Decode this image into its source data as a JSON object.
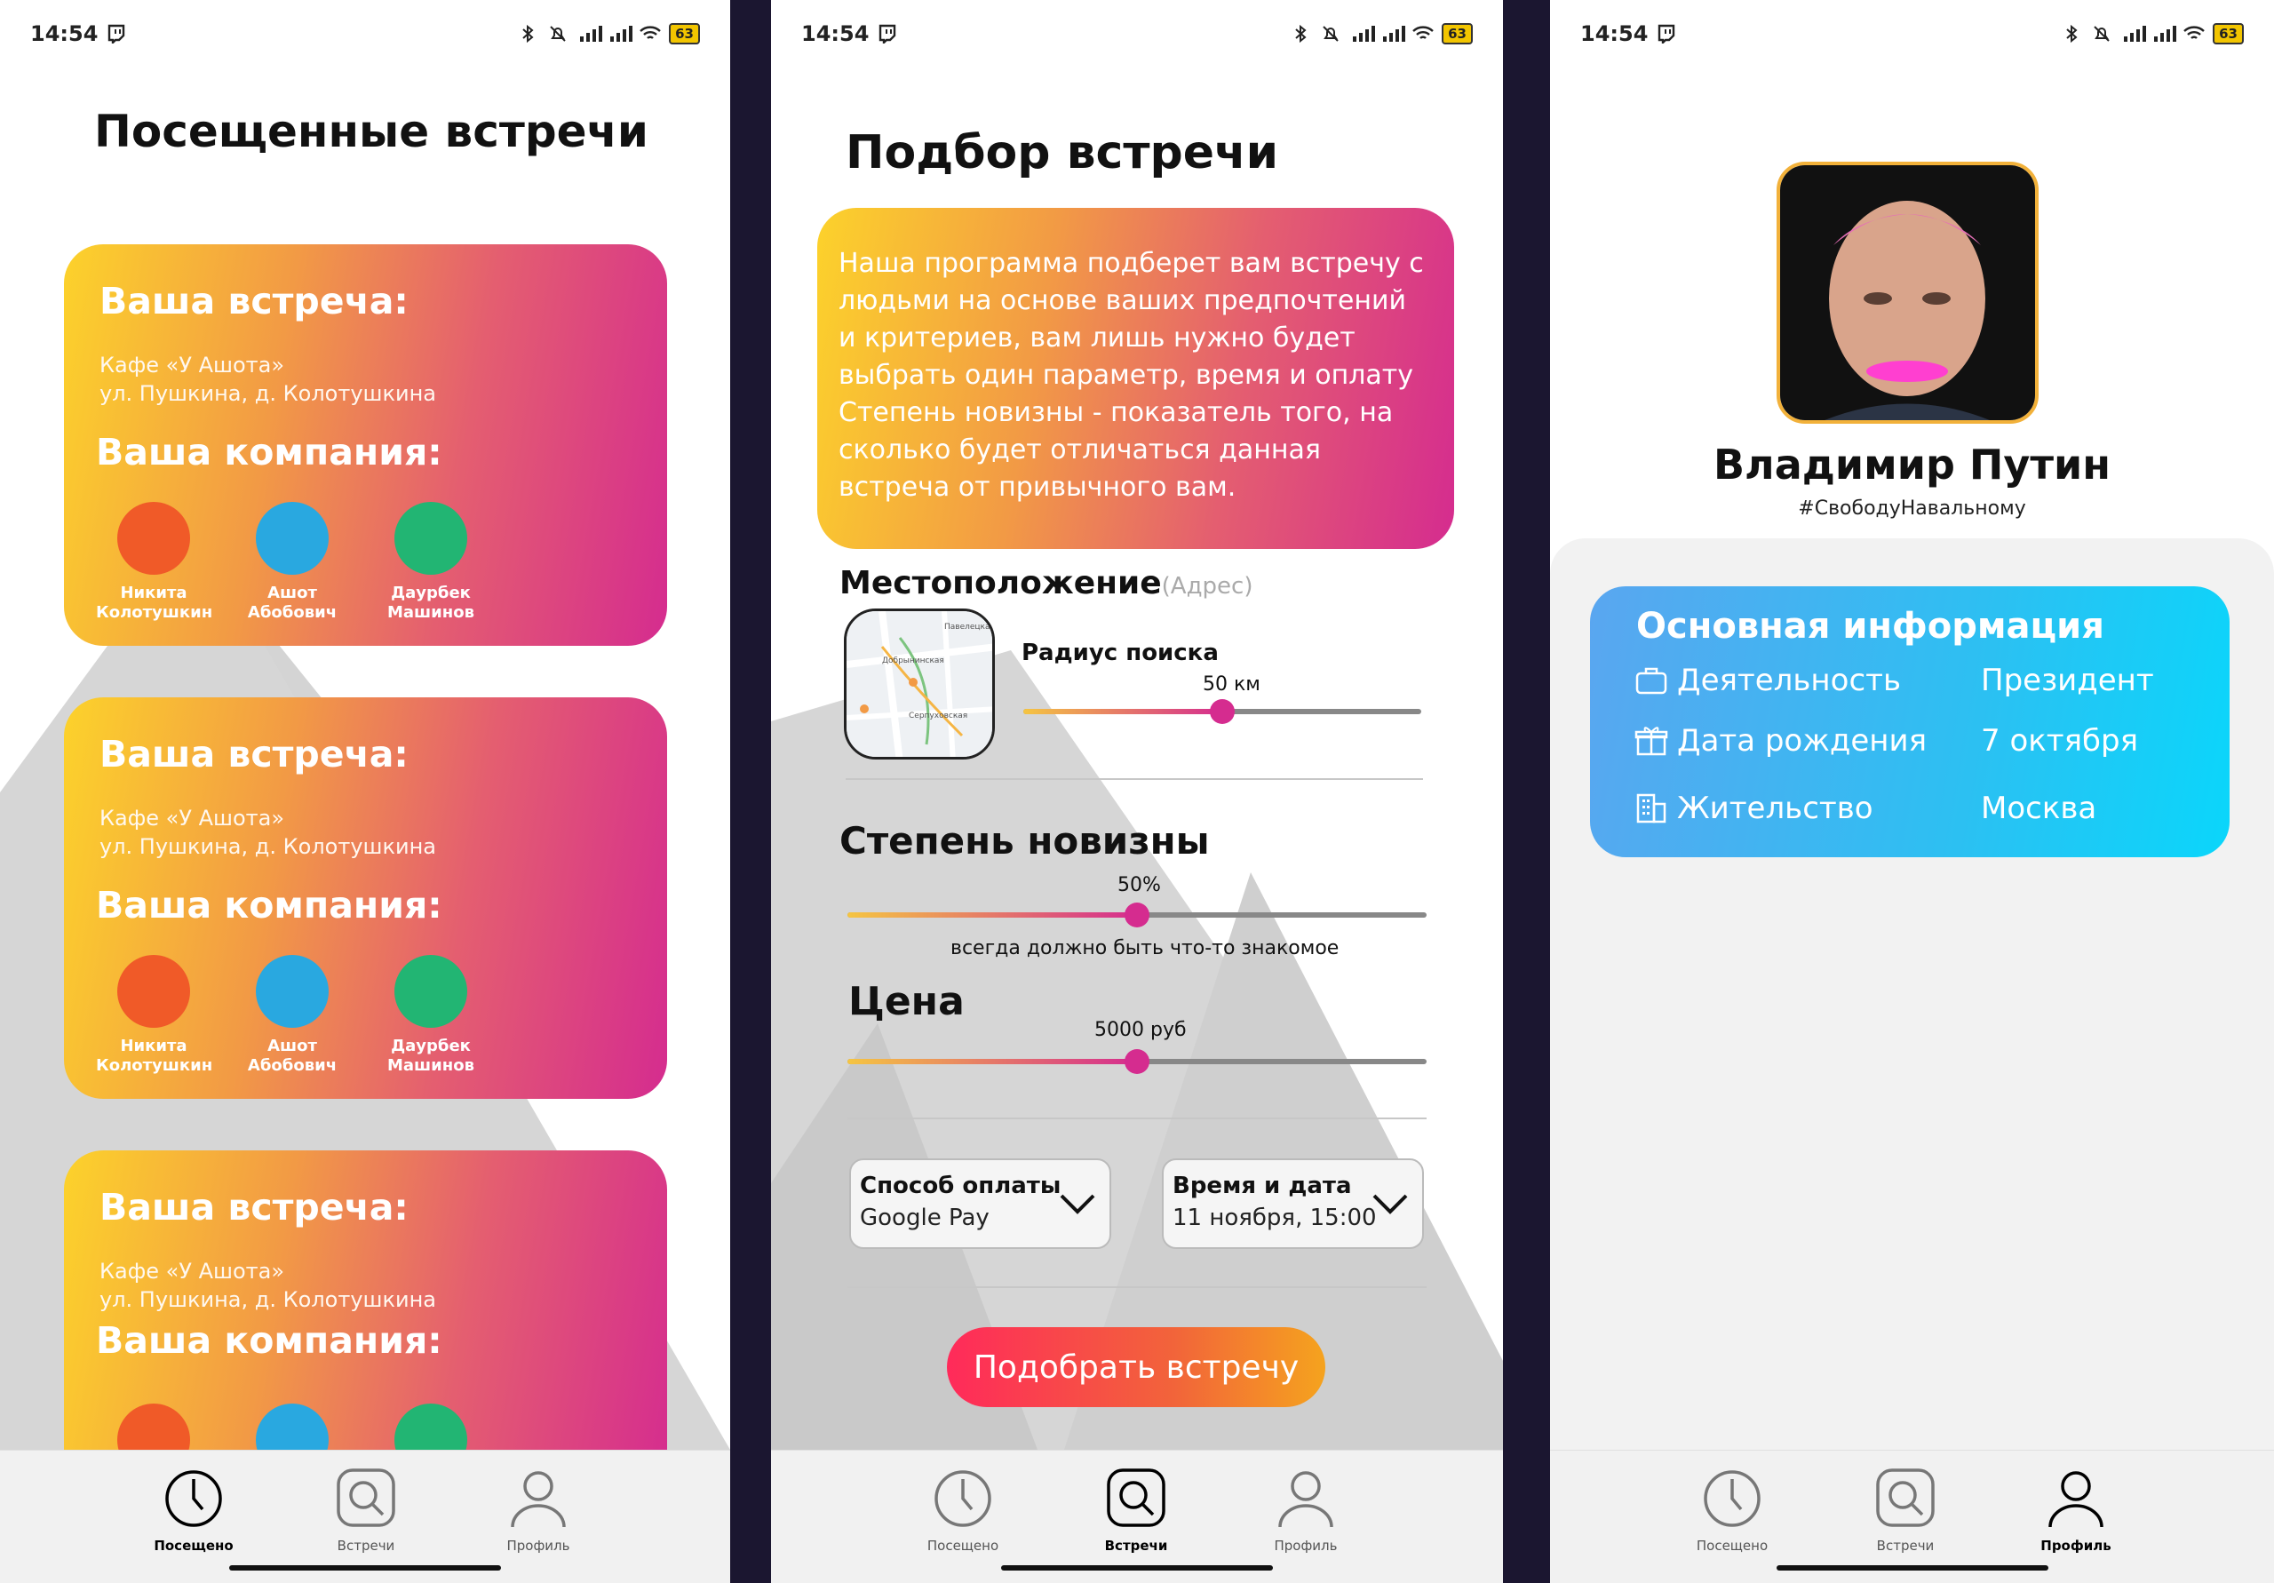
{
  "status": {
    "time": "14:54",
    "battery": "63"
  },
  "nav": {
    "visited": "Посещено",
    "meetings": "Встречи",
    "profile": "Профиль"
  },
  "visited": {
    "title": "Посещенные встречи",
    "cards": [
      {
        "heading": "Ваша встреча:",
        "place": "Кафе «У Ашота»",
        "address": "ул. Пушкина, д. Колотушкина",
        "company_heading": "Ваша компания:",
        "people": [
          {
            "name": "Никита Колотушкин",
            "color": "#f05a28"
          },
          {
            "name": "Ашот Абобович",
            "color": "#29a8e0"
          },
          {
            "name": "Даурбек Машинов",
            "color": "#22b573"
          }
        ]
      },
      {
        "heading": "Ваша встреча:",
        "place": "Кафе «У Ашота»",
        "address": "ул. Пушкина, д. Колотушкина",
        "company_heading": "Ваша компания:",
        "people": [
          {
            "name": "Никита Колотушкин",
            "color": "#f05a28"
          },
          {
            "name": "Ашот Абобович",
            "color": "#29a8e0"
          },
          {
            "name": "Даурбек Машинов",
            "color": "#22b573"
          }
        ]
      },
      {
        "heading": "Ваша встреча:",
        "place": "Кафе «У Ашота»",
        "address": "ул. Пушкина, д. Колотушкина",
        "company_heading": "Ваша компания:",
        "people": [
          {
            "name": "",
            "color": "#f05a28"
          },
          {
            "name": "",
            "color": "#29a8e0"
          },
          {
            "name": "",
            "color": "#22b573"
          }
        ]
      }
    ]
  },
  "pick": {
    "title": "Подбор встречи",
    "description": "Наша программа подберет вам встречу с людьми на основе ваших предпочтений и критериев, вам лишь нужно будет выбрать один параметр, время и оплату\nСтепень новизны - показатель того, на сколько будет отличаться данная встреча от привычного вам.",
    "location_label": "Местоположение",
    "location_hint": "(Адрес)",
    "radius_label": "Радиус поиска",
    "radius_value": "50 км",
    "radius_fraction": 0.5,
    "novelty_label": "Степень новизны",
    "novelty_value": "50%",
    "novelty_fraction": 0.5,
    "novelty_caption": "всегда должно быть что-то знакомое",
    "price_label": "Цена",
    "price_value": "5000 руб",
    "price_fraction": 0.5,
    "payment_title": "Способ оплаты",
    "payment_value": "Google Pay",
    "datetime_title": "Время и дата",
    "datetime_value": "11 ноября, 15:00",
    "submit": "Подобрать встречу",
    "map_labels": {
      "a": "Добрынинская",
      "b": "Серпуховская",
      "c": "Павелецкая"
    }
  },
  "profile": {
    "name": "Владимир Путин",
    "tag": "#СвободуНавальному",
    "info_title": "Основная информация",
    "rows": [
      {
        "label": "Деятельность",
        "value": "Президент",
        "icon": "briefcase-icon"
      },
      {
        "label": "Дата рождения",
        "value": "7 октября",
        "icon": "gift-icon"
      },
      {
        "label": "Жительство",
        "value": "Москва",
        "icon": "building-icon"
      }
    ]
  },
  "colors": {
    "accent_pink": "#d52c8f",
    "accent_yellow": "#fcd22b",
    "info_blue": "#2cc0f2"
  }
}
